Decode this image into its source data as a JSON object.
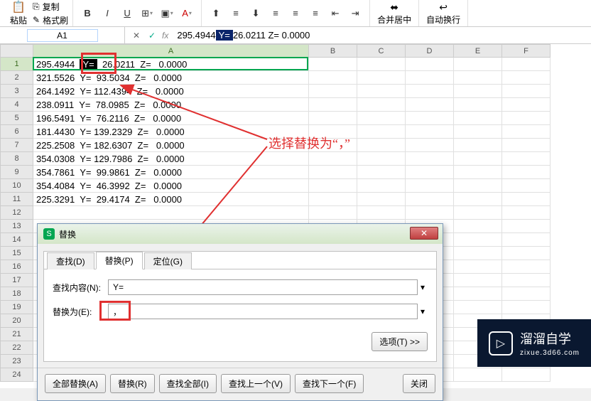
{
  "ribbon": {
    "paste": "粘贴",
    "copy": "复制",
    "format_paint": "格式刷",
    "merge_center": "合并居中",
    "auto_wrap": "自动换行"
  },
  "namebar": {
    "cell_ref": "A1"
  },
  "formula": {
    "pre": "295.4944",
    "sel": "Y=",
    "post": "26.0211  Z=   0.0000"
  },
  "columns": [
    "A",
    "B",
    "C",
    "D",
    "E",
    "F"
  ],
  "rows": [
    "295.4944  Y=  26.0211  Z=   0.0000",
    "321.5526  Y=  93.5034  Z=   0.0000",
    "264.1492  Y= 112.4394  Z=   0.0000",
    "238.0911  Y=  78.0985  Z=   0.0000",
    "196.5491  Y=  76.2116  Z=   0.0000",
    "181.4430  Y= 139.2329  Z=   0.0000",
    "225.2508  Y= 182.6307  Z=   0.0000",
    "354.0308  Y= 129.7986  Z=   0.0000",
    "354.7861  Y=  99.9861  Z=   0.0000",
    "354.4084  Y=  46.3992  Z=   0.0000",
    "225.3291  Y=  29.4174  Z=   0.0000"
  ],
  "annotation": {
    "text": "选择替换为“，”"
  },
  "dialog": {
    "title": "替换",
    "tabs": {
      "find": "查找(D)",
      "replace": "替换(P)",
      "locate": "定位(G)"
    },
    "find_label": "查找内容(N):",
    "find_value": "Y=",
    "replace_label": "替换为(E):",
    "replace_value": "，",
    "options_btn": "选项(T) >>",
    "buttons": {
      "replace_all": "全部替换(A)",
      "replace": "替换(R)",
      "find_all": "查找全部(I)",
      "find_prev": "查找上一个(V)",
      "find_next": "查找下一个(F)",
      "close": "关闭"
    }
  },
  "watermark": {
    "brand": "溜溜自学",
    "url": "zixue.3d66.com"
  }
}
